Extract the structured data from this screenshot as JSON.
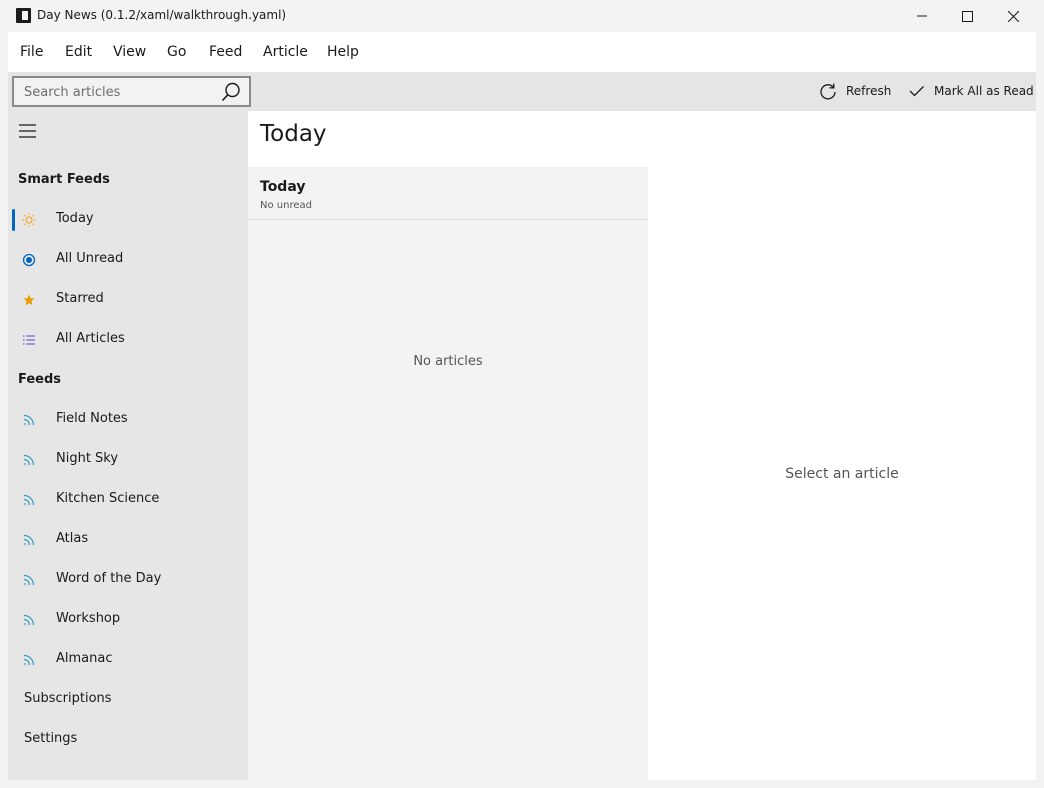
{
  "window": {
    "title": "Day News (0.1.2/xaml/walkthrough.yaml)"
  },
  "menu": [
    "File",
    "Edit",
    "View",
    "Go",
    "Feed",
    "Article",
    "Help"
  ],
  "toolbar": {
    "search_placeholder": "Search articles",
    "refresh_label": "Refresh",
    "mark_all_label": "Mark All as Read"
  },
  "sidebar": {
    "smart_feeds_title": "Smart Feeds",
    "smart_feeds": [
      {
        "label": "Today",
        "icon": "sun-icon"
      },
      {
        "label": "All Unread",
        "icon": "radio-dot-icon"
      },
      {
        "label": "Starred",
        "icon": "star-icon"
      },
      {
        "label": "All Articles",
        "icon": "list-icon"
      }
    ],
    "feeds_title": "Feeds",
    "feeds": [
      {
        "label": "Field Notes",
        "icon": "rss-icon"
      },
      {
        "label": "Night Sky",
        "icon": "rss-icon"
      },
      {
        "label": "Kitchen Science",
        "icon": "rss-icon"
      },
      {
        "label": "Atlas",
        "icon": "rss-icon"
      },
      {
        "label": "Word of the Day",
        "icon": "rss-icon"
      },
      {
        "label": "Workshop",
        "icon": "rss-icon"
      },
      {
        "label": "Almanac",
        "icon": "rss-icon"
      }
    ],
    "subscriptions_label": "Subscriptions",
    "settings_label": "Settings"
  },
  "main": {
    "title": "Today",
    "list": {
      "header_title": "Today",
      "header_subtitle": "No unread",
      "empty_text": "No articles"
    },
    "reader": {
      "empty_text": "Select an article"
    }
  },
  "colors": {
    "accent": "#0067c0",
    "sun": "#f2a93b",
    "star": "#e8a000",
    "list_icon": "#6a5acd",
    "rss": "#3a9ec4"
  }
}
